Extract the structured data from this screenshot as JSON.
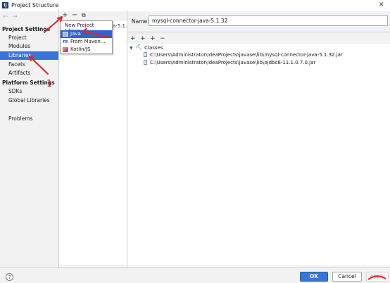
{
  "window": {
    "title": "Project Structure",
    "app_icon": "intellij-icon"
  },
  "sidebar": {
    "project_settings_header": "Project Settings",
    "project_settings_items": [
      "Project",
      "Modules",
      "Libraries",
      "Facets",
      "Artifacts"
    ],
    "platform_settings_header": "Platform Settings",
    "platform_settings_items": [
      "SDKs",
      "Global Libraries"
    ],
    "problems": "Problems",
    "selected": "Libraries"
  },
  "libraries_toolbar": {
    "add": "+",
    "remove": "−",
    "copy": "⧉"
  },
  "library_list_peek": "a-5.1.",
  "popup": {
    "title": "New Project Library",
    "items": [
      {
        "label": "Java",
        "icon": "java-library-icon",
        "selected": true
      },
      {
        "label": "From Maven...",
        "icon": "maven-icon",
        "selected": false
      },
      {
        "label": "Kotlin/JS",
        "icon": "kotlin-icon",
        "selected": false
      }
    ]
  },
  "detail": {
    "name_label": "Name:",
    "name_value": "mysql-connector-java-5.1.32",
    "toolbar": {
      "add": "+",
      "add_alt": "+",
      "add_special": "+",
      "remove": "−"
    },
    "tree": {
      "root_label": "Classes",
      "jars": [
        "C:\\Users\\Administrator\\IdeaProjects\\javase\\lib\\mysql-connector-java-5.1.32.jar",
        "C:\\Users\\Administrator\\IdeaProjects\\javase\\lib\\ojdbc6-11.1.0.7.0.jar"
      ]
    }
  },
  "footer": {
    "help": "?",
    "ok": "OK",
    "cancel": "Cancel",
    "apply": "Apply"
  },
  "annotation": {
    "number": "1",
    "color": "#e0242a"
  },
  "colors": {
    "selection": "#3875d6",
    "popup_selection": "#2f65ca"
  }
}
